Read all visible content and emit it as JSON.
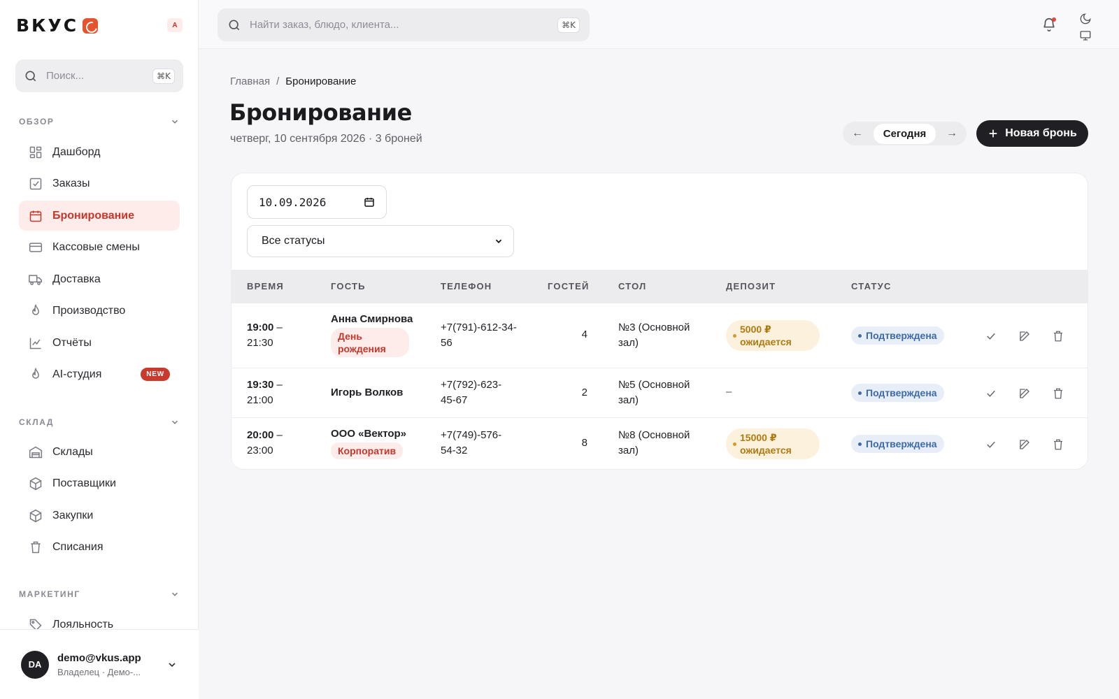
{
  "brand": {
    "name": "ВКУС",
    "user_initial": "A"
  },
  "sidebar": {
    "search": {
      "placeholder": "Поиск...",
      "shortcut": "⌘K"
    },
    "sections": [
      {
        "title": "ОБЗОР",
        "items": [
          {
            "label": "Дашборд",
            "icon": "grid-icon"
          },
          {
            "label": "Заказы",
            "icon": "checkbox-icon"
          },
          {
            "label": "Бронирование",
            "icon": "calendar-icon",
            "active": true
          },
          {
            "label": "Кассовые смены",
            "icon": "card-icon"
          },
          {
            "label": "Доставка",
            "icon": "truck-icon"
          },
          {
            "label": "Производство",
            "icon": "flame-icon"
          },
          {
            "label": "Отчёты",
            "icon": "chart-icon"
          },
          {
            "label": "AI-студия",
            "icon": "flame-icon",
            "badge": "NEW"
          }
        ]
      },
      {
        "title": "СКЛАД",
        "items": [
          {
            "label": "Склады",
            "icon": "warehouse-icon"
          },
          {
            "label": "Поставщики",
            "icon": "box-icon"
          },
          {
            "label": "Закупки",
            "icon": "box-icon"
          },
          {
            "label": "Списания",
            "icon": "trash-icon"
          }
        ]
      },
      {
        "title": "МАРКЕТИНГ",
        "items": [
          {
            "label": "Лояльность",
            "icon": "tag-icon"
          }
        ]
      }
    ]
  },
  "user": {
    "initials": "DA",
    "email": "demo@vkus.app",
    "role": "Владелец · Демо-..."
  },
  "topbar": {
    "search_placeholder": "Найти заказ, блюдо, клиента...",
    "shortcut": "⌘K"
  },
  "breadcrumb": {
    "home": "Главная",
    "separator": "/",
    "current": "Бронирование"
  },
  "page": {
    "title": "Бронирование",
    "subtitle": "четверг, 10 сентября 2026 · 3 броней"
  },
  "day_nav": {
    "prev": "←",
    "today": "Сегодня",
    "next": "→"
  },
  "new_button": {
    "label": "Новая бронь"
  },
  "filters": {
    "date": "10.09.2026",
    "status": "Все статусы"
  },
  "table": {
    "columns": [
      "ВРЕМЯ",
      "ГОСТЬ",
      "ТЕЛЕФОН",
      "ГОСТЕЙ",
      "СТОЛ",
      "ДЕПОЗИТ",
      "СТАТУС"
    ],
    "rows": [
      {
        "time_from": "19:00",
        "time_dash": " –",
        "time_to": "21:30",
        "guest": "Анна Смирнова",
        "tag": "День рождения",
        "phone_a": "+7(791)-612-34-",
        "phone_b": "56",
        "guests": "4",
        "table_a": "№3 (Основной",
        "table_b": "зал)",
        "deposit_a": "5000 ₽",
        "deposit_b": "ожидается",
        "status": "Подтверждена"
      },
      {
        "time_from": "19:30",
        "time_dash": " –",
        "time_to": "21:00",
        "guest": "Игорь Волков",
        "tag": "",
        "phone_a": "+7(792)-623-",
        "phone_b": "45-67",
        "guests": "2",
        "table_a": "№5 (Основной",
        "table_b": "зал)",
        "deposit_empty": "–",
        "status": "Подтверждена"
      },
      {
        "time_from": "20:00",
        "time_dash": " –",
        "time_to": "23:00",
        "guest": "ООО «Вектор»",
        "tag": "Корпоратив",
        "phone_a": "+7(749)-576-",
        "phone_b": "54-32",
        "guests": "8",
        "table_a": "№8 (Основной",
        "table_b": "зал)",
        "deposit_a": "15000 ₽",
        "deposit_b": "ожидается",
        "status": "Подтверждена"
      }
    ]
  },
  "colors": {
    "accent": "#c6372b",
    "brand": "#e5542e",
    "dark": "#1f1f24",
    "deposit": "#b07a10",
    "status": "#3d6aa8"
  }
}
